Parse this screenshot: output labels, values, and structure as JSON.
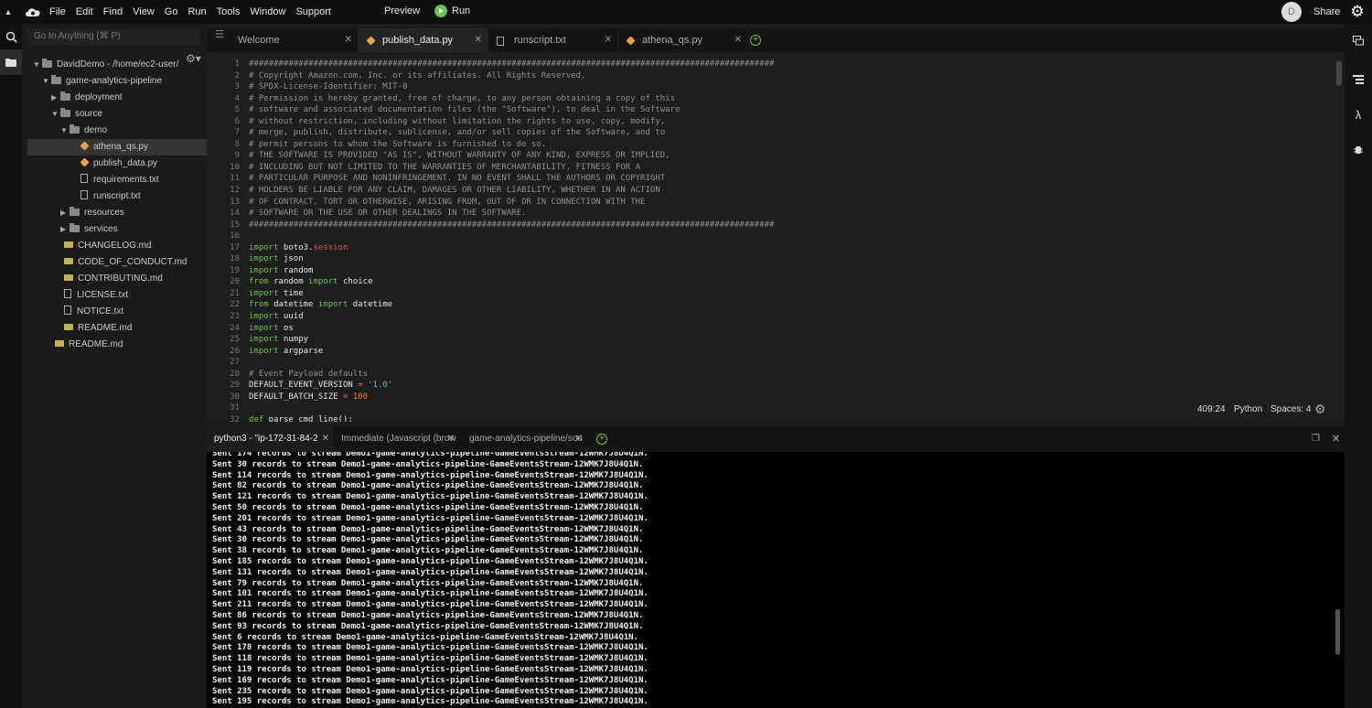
{
  "menubar": {
    "items": [
      "File",
      "Edit",
      "Find",
      "View",
      "Go",
      "Run",
      "Tools",
      "Window",
      "Support"
    ],
    "preview_label": "Preview",
    "run_label": "Run",
    "avatar_initial": "D",
    "share_label": "Share"
  },
  "sidebar": {
    "goto_placeholder": "Go to Anything (⌘ P)",
    "tree": [
      {
        "label": "DavidDemo - /home/ec2-user/",
        "type": "folder",
        "expanded": true
      },
      {
        "label": "game-analytics-pipeline",
        "type": "folder",
        "expanded": true
      },
      {
        "label": "deployment",
        "type": "folder",
        "expanded": false
      },
      {
        "label": "source",
        "type": "folder",
        "expanded": true
      },
      {
        "label": "demo",
        "type": "folder",
        "expanded": true
      },
      {
        "label": "athena_qs.py",
        "type": "py",
        "selected": true
      },
      {
        "label": "publish_data.py",
        "type": "py"
      },
      {
        "label": "requirements.txt",
        "type": "txt"
      },
      {
        "label": "runscript.txt",
        "type": "txt"
      },
      {
        "label": "resources",
        "type": "folder",
        "expanded": false
      },
      {
        "label": "services",
        "type": "folder",
        "expanded": false
      },
      {
        "label": "CHANGELOG.md",
        "type": "md"
      },
      {
        "label": "CODE_OF_CONDUCT.md",
        "type": "md"
      },
      {
        "label": "CONTRIBUTING.md",
        "type": "md"
      },
      {
        "label": "LICENSE.txt",
        "type": "txt"
      },
      {
        "label": "NOTICE.txt",
        "type": "txt"
      },
      {
        "label": "README.md",
        "type": "md"
      },
      {
        "label": "README.md",
        "type": "md"
      }
    ]
  },
  "editor": {
    "tabs": [
      {
        "label": "Welcome",
        "active": false
      },
      {
        "label": "publish_data.py",
        "active": true
      },
      {
        "label": "runscript.txt",
        "active": false
      },
      {
        "label": "athena_qs.py",
        "active": false
      }
    ],
    "code_lines": [
      "##########################################################################################################",
      "# Copyright Amazon.com, Inc. or its affiliates. All Rights Reserved.",
      "# SPDX-License-Identifier: MIT-0",
      "# Permission is hereby granted, free of charge, to any person obtaining a copy of this",
      "# software and associated documentation files (the \"Software\"), to deal in the Software",
      "# without restriction, including without limitation the rights to use, copy, modify,",
      "# merge, publish, distribute, sublicense, and/or sell copies of the Software, and to",
      "# permit persons to whom the Software is furnished to do so.",
      "# THE SOFTWARE IS PROVIDED \"AS IS\", WITHOUT WARRANTY OF ANY KIND, EXPRESS OR IMPLIED,",
      "# INCLUDING BUT NOT LIMITED TO THE WARRANTIES OF MERCHANTABILITY, FITNESS FOR A",
      "# PARTICULAR PURPOSE AND NONINFRINGEMENT. IN NO EVENT SHALL THE AUTHORS OR COPYRIGHT",
      "# HOLDERS BE LIABLE FOR ANY CLAIM, DAMAGES OR OTHER LIABILITY, WHETHER IN AN ACTION",
      "# OF CONTRACT, TORT OR OTHERWISE, ARISING FROM, OUT OF OR IN CONNECTION WITH THE",
      "# SOFTWARE OR THE USE OR OTHER DEALINGS IN THE SOFTWARE.",
      "##########################################################################################################",
      "",
      "import boto3.session",
      "import json",
      "import random",
      "from random import choice",
      "import time",
      "from datetime import datetime",
      "import uuid",
      "import os",
      "import numpy",
      "import argparse",
      "",
      "# Event Payload defaults",
      "DEFAULT_EVENT_VERSION = '1.0'",
      "DEFAULT_BATCH_SIZE = 100",
      "",
      "def parse_cmd_line():"
    ],
    "status": {
      "cursor": "409:24",
      "language": "Python",
      "spaces": "Spaces: 4"
    }
  },
  "terminal": {
    "tabs": [
      {
        "label": "python3 - \"ip-172-31-84-2",
        "active": true
      },
      {
        "label": "Immediate (Javascript (brow",
        "active": false
      },
      {
        "label": "game-analytics-pipeline/sou",
        "active": false
      }
    ],
    "lines": [
      "Sent 174 records to stream Demo1-game-analytics-pipeline-GameEventsStream-12WMK7J8U4Q1N.",
      "Sent 30 records to stream Demo1-game-analytics-pipeline-GameEventsStream-12WMK7J8U4Q1N.",
      "Sent 114 records to stream Demo1-game-analytics-pipeline-GameEventsStream-12WMK7J8U4Q1N.",
      "Sent 82 records to stream Demo1-game-analytics-pipeline-GameEventsStream-12WMK7J8U4Q1N.",
      "Sent 121 records to stream Demo1-game-analytics-pipeline-GameEventsStream-12WMK7J8U4Q1N.",
      "Sent 50 records to stream Demo1-game-analytics-pipeline-GameEventsStream-12WMK7J8U4Q1N.",
      "Sent 201 records to stream Demo1-game-analytics-pipeline-GameEventsStream-12WMK7J8U4Q1N.",
      "Sent 43 records to stream Demo1-game-analytics-pipeline-GameEventsStream-12WMK7J8U4Q1N.",
      "Sent 30 records to stream Demo1-game-analytics-pipeline-GameEventsStream-12WMK7J8U4Q1N.",
      "Sent 38 records to stream Demo1-game-analytics-pipeline-GameEventsStream-12WMK7J8U4Q1N.",
      "Sent 185 records to stream Demo1-game-analytics-pipeline-GameEventsStream-12WMK7J8U4Q1N.",
      "Sent 131 records to stream Demo1-game-analytics-pipeline-GameEventsStream-12WMK7J8U4Q1N.",
      "Sent 79 records to stream Demo1-game-analytics-pipeline-GameEventsStream-12WMK7J8U4Q1N.",
      "Sent 101 records to stream Demo1-game-analytics-pipeline-GameEventsStream-12WMK7J8U4Q1N.",
      "Sent 211 records to stream Demo1-game-analytics-pipeline-GameEventsStream-12WMK7J8U4Q1N.",
      "Sent 86 records to stream Demo1-game-analytics-pipeline-GameEventsStream-12WMK7J8U4Q1N.",
      "Sent 93 records to stream Demo1-game-analytics-pipeline-GameEventsStream-12WMK7J8U4Q1N.",
      "Sent 6 records to stream Demo1-game-analytics-pipeline-GameEventsStream-12WMK7J8U4Q1N.",
      "Sent 178 records to stream Demo1-game-analytics-pipeline-GameEventsStream-12WMK7J8U4Q1N.",
      "Sent 118 records to stream Demo1-game-analytics-pipeline-GameEventsStream-12WMK7J8U4Q1N.",
      "Sent 119 records to stream Demo1-game-analytics-pipeline-GameEventsStream-12WMK7J8U4Q1N.",
      "Sent 169 records to stream Demo1-game-analytics-pipeline-GameEventsStream-12WMK7J8U4Q1N.",
      "Sent 235 records to stream Demo1-game-analytics-pipeline-GameEventsStream-12WMK7J8U4Q1N.",
      "Sent 195 records to stream Demo1-game-analytics-pipeline-GameEventsStream-12WMK7J8U4Q1N."
    ]
  },
  "rightbar": {
    "lambda_glyph": "λ"
  },
  "colors": {
    "accent_green": "#6cbf52",
    "py_icon": "#e8a24a",
    "md_icon": "#c6b14b",
    "comment": "#8f8f8f",
    "string": "#5db1ce",
    "number": "#e87c2e"
  }
}
